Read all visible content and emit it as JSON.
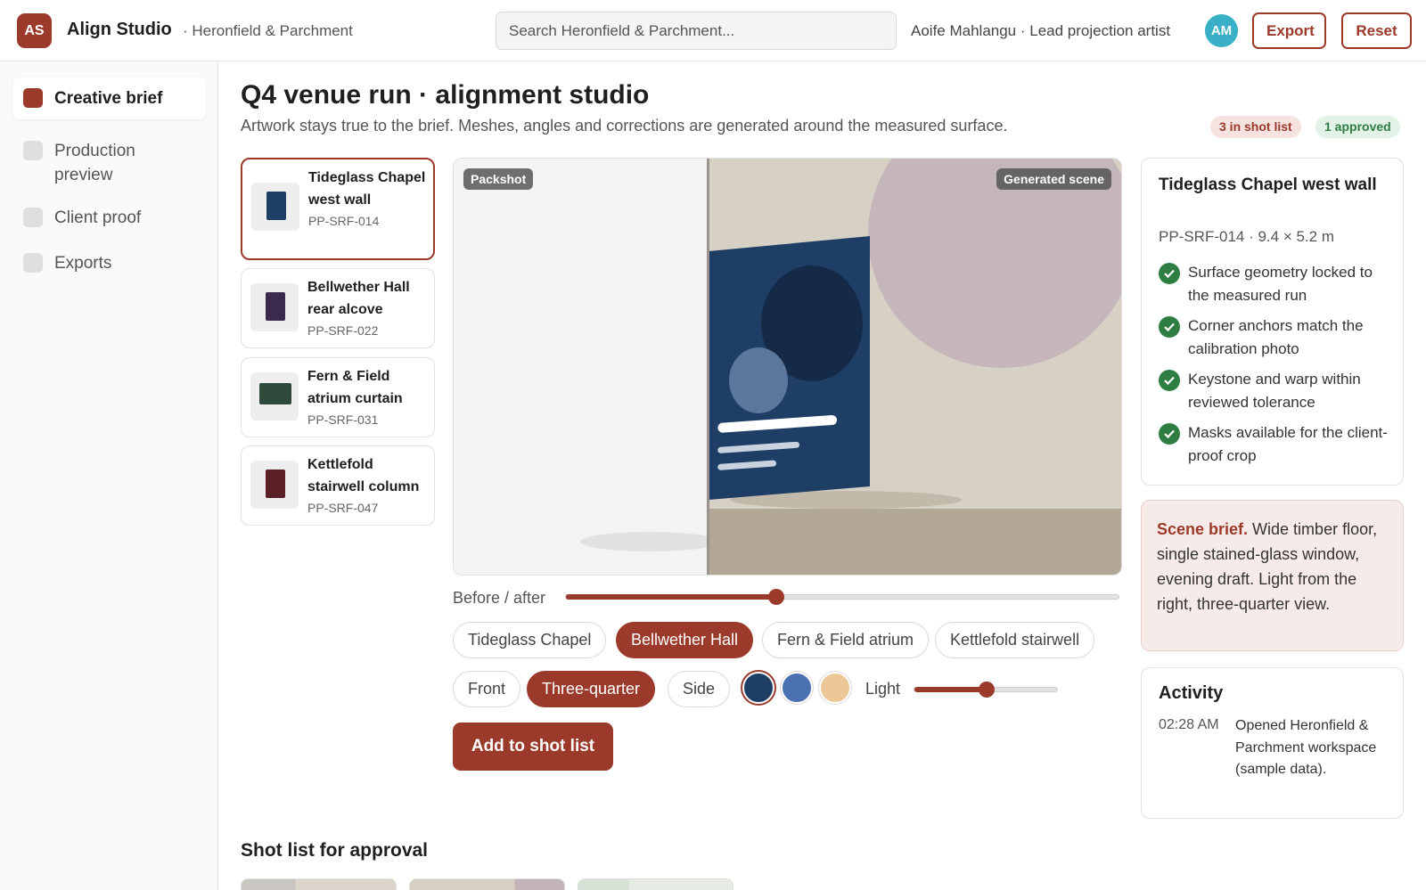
{
  "app": {
    "logo_initials": "AS",
    "title": "Align Studio",
    "workspace": "· Heronfield & Parchment",
    "search_placeholder": "Search Heronfield & Parchment...",
    "user": "Aoife Mahlangu · Lead projection artist",
    "avatar_initials": "AM",
    "export_label": "Export",
    "reset_label": "Reset",
    "brand_color": "#9b3a2a"
  },
  "sidebar": {
    "items": [
      {
        "label": "Creative brief",
        "active": true
      },
      {
        "label": "Production preview",
        "active": false
      },
      {
        "label": "Client proof",
        "active": false
      },
      {
        "label": "Exports",
        "active": false
      }
    ]
  },
  "main": {
    "title": "Q4 venue run · alignment studio",
    "subtitle": "Artwork stays true to the brief. Meshes, angles and corrections are generated around the measured surface.",
    "badges": {
      "shot_list": "3 in shot list",
      "approved": "1 approved"
    }
  },
  "surfaces": [
    {
      "name": "Tideglass Chapel west wall",
      "code": "PP-SRF-014",
      "selected": true,
      "art_color": "#1f3e66",
      "icon": "poster-thumb"
    },
    {
      "name": "Bellwether Hall rear alcove",
      "code": "PP-SRF-022",
      "selected": false,
      "art_color": "#3c2a4d",
      "icon": "poster-thumb"
    },
    {
      "name": "Fern & Field atrium curtain",
      "code": "PP-SRF-031",
      "selected": false,
      "art_color": "#2d4a3a",
      "icon": "banner-thumb"
    },
    {
      "name": "Kettlefold stairwell column",
      "code": "PP-SRF-047",
      "selected": false,
      "art_color": "#5a1f24",
      "icon": "poster-thumb"
    }
  ],
  "stage": {
    "packshot_label": "Packshot",
    "generated_label": "Generated scene",
    "art_color": "#1f3e66"
  },
  "controls": {
    "before_after_label": "Before / after",
    "before_after_value": 0.38,
    "venues": [
      {
        "label": "Tideglass Chapel",
        "on": false
      },
      {
        "label": "Bellwether Hall",
        "on": true
      },
      {
        "label": "Fern & Field atrium",
        "on": false
      },
      {
        "label": "Kettlefold stairwell",
        "on": false
      }
    ],
    "angles": [
      {
        "label": "Front",
        "on": false
      },
      {
        "label": "Three-quarter",
        "on": true
      },
      {
        "label": "Side",
        "on": false
      }
    ],
    "swatches": [
      {
        "color": "#1f3e66",
        "on": true
      },
      {
        "color": "#4a72b0",
        "on": false
      },
      {
        "color": "#ecc898",
        "on": false
      }
    ],
    "light_label": "Light",
    "light_value": 0.5,
    "cta_label": "Add to shot list"
  },
  "shot_list": {
    "title": "Shot list for approval"
  },
  "details": {
    "title": "Tideglass Chapel west wall",
    "meta": "PP-SRF-014 · 9.4 × 5.2 m",
    "checks": [
      "Surface geometry locked to the measured run",
      "Corner anchors match the calibration photo",
      "Keystone and warp within reviewed tolerance",
      "Masks available for the client-proof crop"
    ]
  },
  "brief": {
    "lead": "Scene brief.",
    "text": " Wide timber floor, single stained-glass window, evening draft. Light from the right, three-quarter view."
  },
  "activity": {
    "title": "Activity",
    "time": "02:28 AM",
    "text": "Opened Heronfield & Parchment workspace (sample data)."
  }
}
